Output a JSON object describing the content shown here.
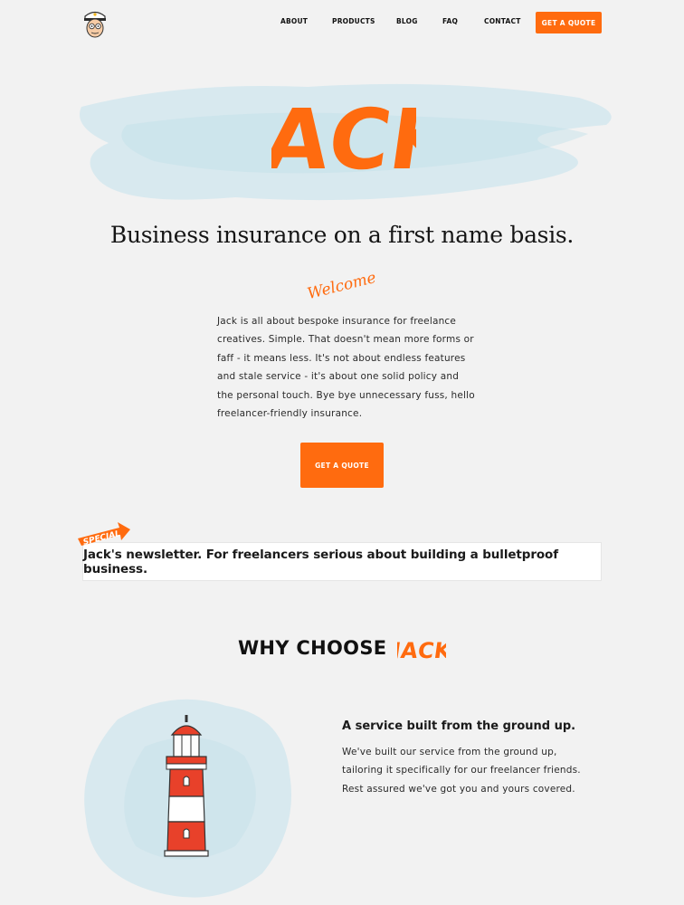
{
  "header": {
    "logo_icon": "captain-avatar-icon",
    "nav": [
      "ABOUT",
      "PRODUCTS",
      "BLOG",
      "FAQ",
      "CONTACT"
    ],
    "quote_button": "GET A QUOTE"
  },
  "hero": {
    "brand_wordmark": "JACK",
    "tagline": "Business insurance on a first name basis.",
    "welcome_script": "Welcome",
    "intro_lines": [
      "Jack is all about bespoke insurance for freelance",
      "creatives. Simple. That doesn't mean more forms or",
      "faff - it means less. It's not about endless features",
      "and stale service - it's about one solid policy and",
      "the personal touch. Bye bye unnecessary fuss, hello",
      "freelancer-friendly insurance."
    ],
    "quote_button": "GET A QUOTE"
  },
  "newsletter": {
    "ribbon": "SPECIAL",
    "text": "Jack's newsletter. For freelancers serious about building a bulletproof business."
  },
  "why": {
    "title": "WHY CHOOSE",
    "title_brand": "JACK"
  },
  "feature": {
    "icon": "lighthouse-icon",
    "title": "A service built from the ground up.",
    "lines": [
      "We've built our service from the ground up,",
      "tailoring it specifically for our freelancer friends.",
      "Rest assured we've got you and yours covered."
    ]
  },
  "colors": {
    "accent": "#ff6b0f",
    "background": "#f2f2f2",
    "wash": "#cfe6ee",
    "lighthouse_red": "#e8412a"
  }
}
